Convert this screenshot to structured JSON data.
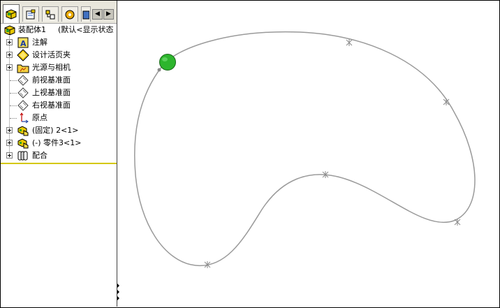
{
  "tree": {
    "root": {
      "label": "装配体1",
      "suffix": "(默认<显示状态"
    },
    "items": [
      {
        "label": "注解"
      },
      {
        "label": "设计活页夹"
      },
      {
        "label": "光源与相机"
      },
      {
        "label": "前视基准面"
      },
      {
        "label": "上视基准面"
      },
      {
        "label": "右视基准面"
      },
      {
        "label": "原点"
      },
      {
        "label": "(固定) 2<1>"
      },
      {
        "label": "(-) 零件3<1>"
      },
      {
        "label": "配合"
      }
    ]
  },
  "tabs": [
    {
      "name": "feature-manager"
    },
    {
      "name": "property-manager"
    },
    {
      "name": "configuration-manager"
    },
    {
      "name": "display-manager"
    }
  ],
  "colors": {
    "curve": "#9a9a9a",
    "ball": "#2db52d",
    "accent_line": "#d4c800"
  }
}
